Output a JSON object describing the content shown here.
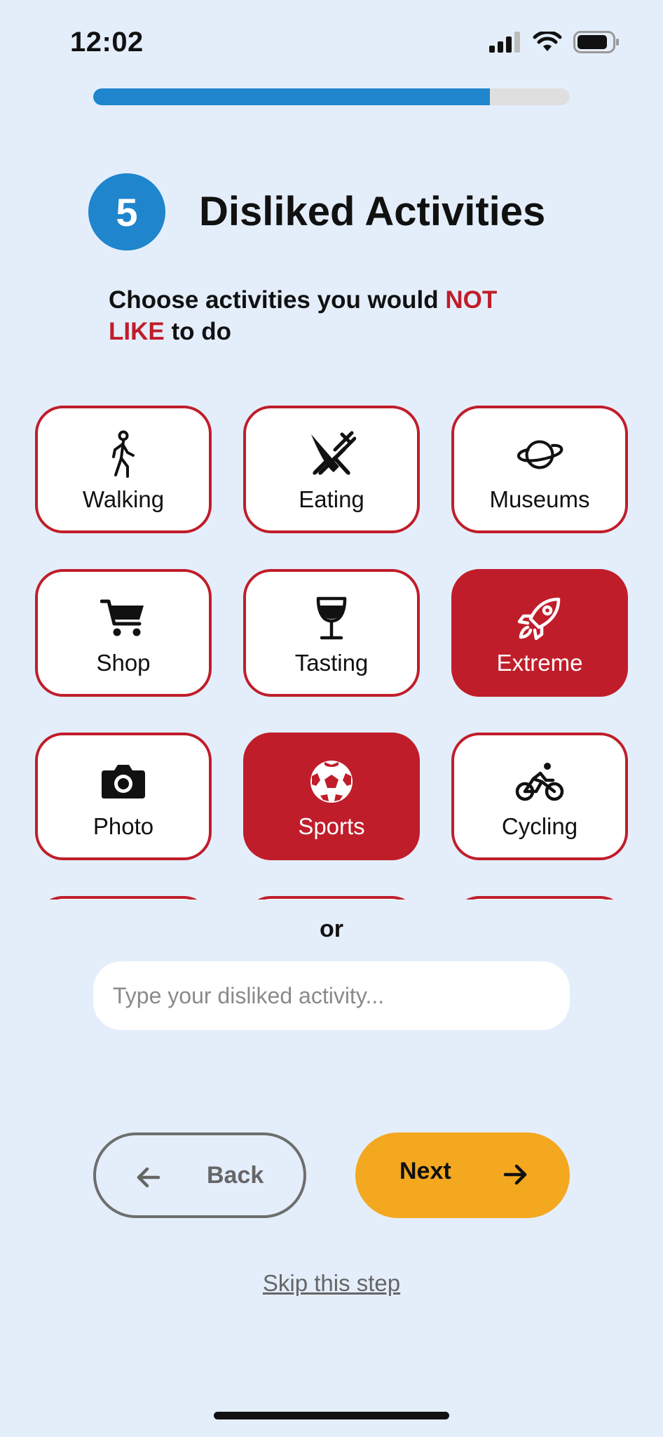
{
  "status_bar": {
    "time": "12:02"
  },
  "progress": {
    "fraction": 0.833
  },
  "step": {
    "number": "5",
    "title": "Disliked Activities"
  },
  "subtitle": {
    "part1": "Choose activities you would ",
    "highlight": "NOT LIKE",
    "part2": " to do"
  },
  "activities": [
    {
      "label": "Walking",
      "icon": "walking-icon",
      "selected": false
    },
    {
      "label": "Eating",
      "icon": "fork-knife-icon",
      "selected": false
    },
    {
      "label": "Museums",
      "icon": "planet-icon",
      "selected": false
    },
    {
      "label": "Shop",
      "icon": "cart-icon",
      "selected": false
    },
    {
      "label": "Tasting",
      "icon": "wine-glass-icon",
      "selected": false
    },
    {
      "label": "Extreme",
      "icon": "rocket-icon",
      "selected": true
    },
    {
      "label": "Photo",
      "icon": "camera-icon",
      "selected": false
    },
    {
      "label": "Sports",
      "icon": "soccer-ball-icon",
      "selected": true
    },
    {
      "label": "Cycling",
      "icon": "cyclist-icon",
      "selected": false
    }
  ],
  "separator": "or",
  "custom_input": {
    "placeholder": "Type your disliked activity...",
    "value": ""
  },
  "buttons": {
    "back": "Back",
    "next": "Next",
    "skip": "Skip this step"
  },
  "colors": {
    "accent_blue": "#1f85cc",
    "selected_red": "#c01d2a",
    "next_orange": "#f3a820",
    "background": "#e4eefb"
  }
}
